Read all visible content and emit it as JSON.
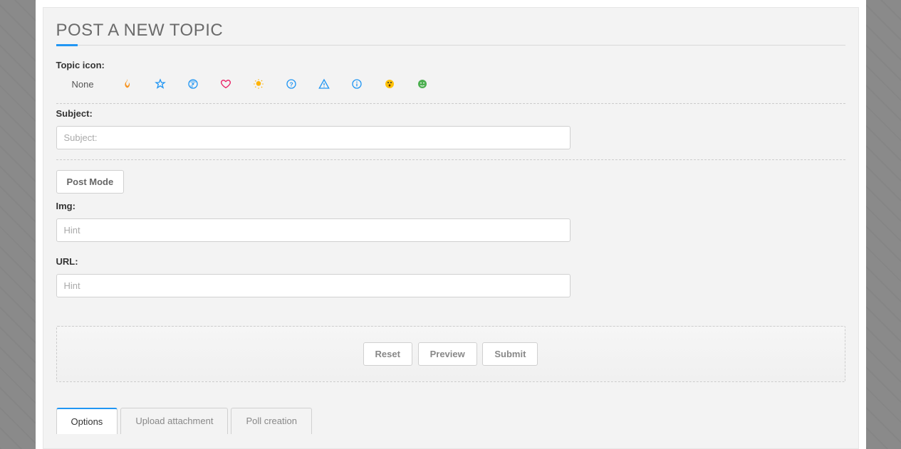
{
  "title": "Post a new topic",
  "topicIcon": {
    "label": "Topic icon:",
    "none": "None"
  },
  "subject": {
    "label": "Subject:",
    "placeholder": "Subject:"
  },
  "postMode": "Post Mode",
  "img": {
    "label": "Img:",
    "placeholder": "Hint"
  },
  "url": {
    "label": "URL:",
    "placeholder": "Hint"
  },
  "actions": {
    "reset": "Reset",
    "preview": "Preview",
    "submit": "Submit"
  },
  "tabs": {
    "options": "Options",
    "upload": "Upload attachment",
    "poll": "Poll creation"
  }
}
